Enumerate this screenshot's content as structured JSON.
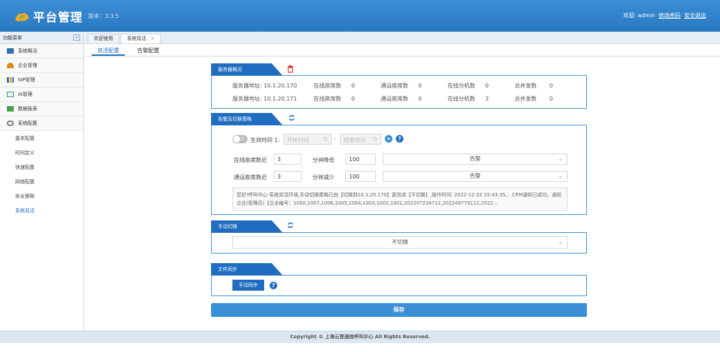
{
  "header": {
    "title": "平台管理",
    "version": "版本：3.3.5",
    "welcome": "欢迎: admin",
    "change_password": "修改密码",
    "logout": "安全退出"
  },
  "sidebar": {
    "header": "功能菜单",
    "collapse_icon": "«",
    "items": [
      {
        "label": "系统概况",
        "icon": "monitor-icon",
        "color": "#3a6ea8"
      },
      {
        "label": "企业管理",
        "icon": "user-icon",
        "color": "#d88a1e"
      },
      {
        "label": "SIP管理",
        "icon": "bar-chart-icon",
        "color": "#2a6bb8"
      },
      {
        "label": "AI管理",
        "icon": "ai-icon",
        "color": "#3c9a5f"
      },
      {
        "label": "数据报表",
        "icon": "table-icon",
        "color": "#4a9d4a"
      },
      {
        "label": "系统配置",
        "icon": "gear-icon",
        "color": "#777777"
      }
    ],
    "subitems": [
      "基本配置",
      "时间定义",
      "快速配置",
      "网络配置",
      "安全策略",
      "系统双活"
    ]
  },
  "tabs": {
    "items": [
      {
        "label": "欢迎使用",
        "closable": false
      },
      {
        "label": "系统双活",
        "closable": true,
        "close": "×"
      }
    ]
  },
  "subtabs": [
    "双活配置",
    "告警配置"
  ],
  "server": {
    "section_title": "服务器概况",
    "rows": [
      {
        "addr_label": "服务器地址:",
        "addr": "10.1.20.170",
        "online_label": "在线座席数",
        "online": "0",
        "call_label": "通话座席数",
        "call": "0",
        "ext_label": "在线分机数",
        "ext": "0",
        "conc_label": "总并发数",
        "conc": "0"
      },
      {
        "addr_label": "服务器地址:",
        "addr": "10.1.20.171",
        "online_label": "在线座席数",
        "online": "0",
        "call_label": "通话座席数",
        "call": "0",
        "ext_label": "在线分机数",
        "ext": "3",
        "conc_label": "总并发数",
        "conc": "0"
      }
    ]
  },
  "alarm": {
    "section_title": "告警及切换策略",
    "toggle_text": "关",
    "effective_label": "生效时间 1:",
    "start_placeholder": "开始时间",
    "end_placeholder": "结束时间",
    "dash": "-",
    "add_icon": "+",
    "help_icon": "?",
    "row1": {
      "label": "在线座席数近",
      "value": "3",
      "label2": "分钟降低",
      "value2": "100",
      "select": "告警"
    },
    "row2": {
      "label": "通话座席数近",
      "value": "3",
      "label2": "分钟减少",
      "value2": "100",
      "select": "告警"
    },
    "message": "您好!呼叫中心-系统双活环境,手动切换策略已由【切换到10.1.20.170】更改成【不切换】,操作时间: 2022-12-22 15:43:35。 CRM通知已成功，通知企业(管理员)【企业编号：1000,1007,1006,1005,1004,1003,1002,1001,202207234712,202249779112,2022..."
  },
  "manual": {
    "section_title": "手动切换",
    "select": "不切换"
  },
  "filesync": {
    "section_title": "文件同步",
    "button": "手动同步",
    "help_icon": "?"
  },
  "save_button": "保存",
  "footer": "Copyright © 上海云晋通信呼叫中心 All Rights Reserved.",
  "colors": {
    "primary": "#1f6cc0",
    "header": "#2a78c2",
    "accent_red": "#e03030"
  }
}
